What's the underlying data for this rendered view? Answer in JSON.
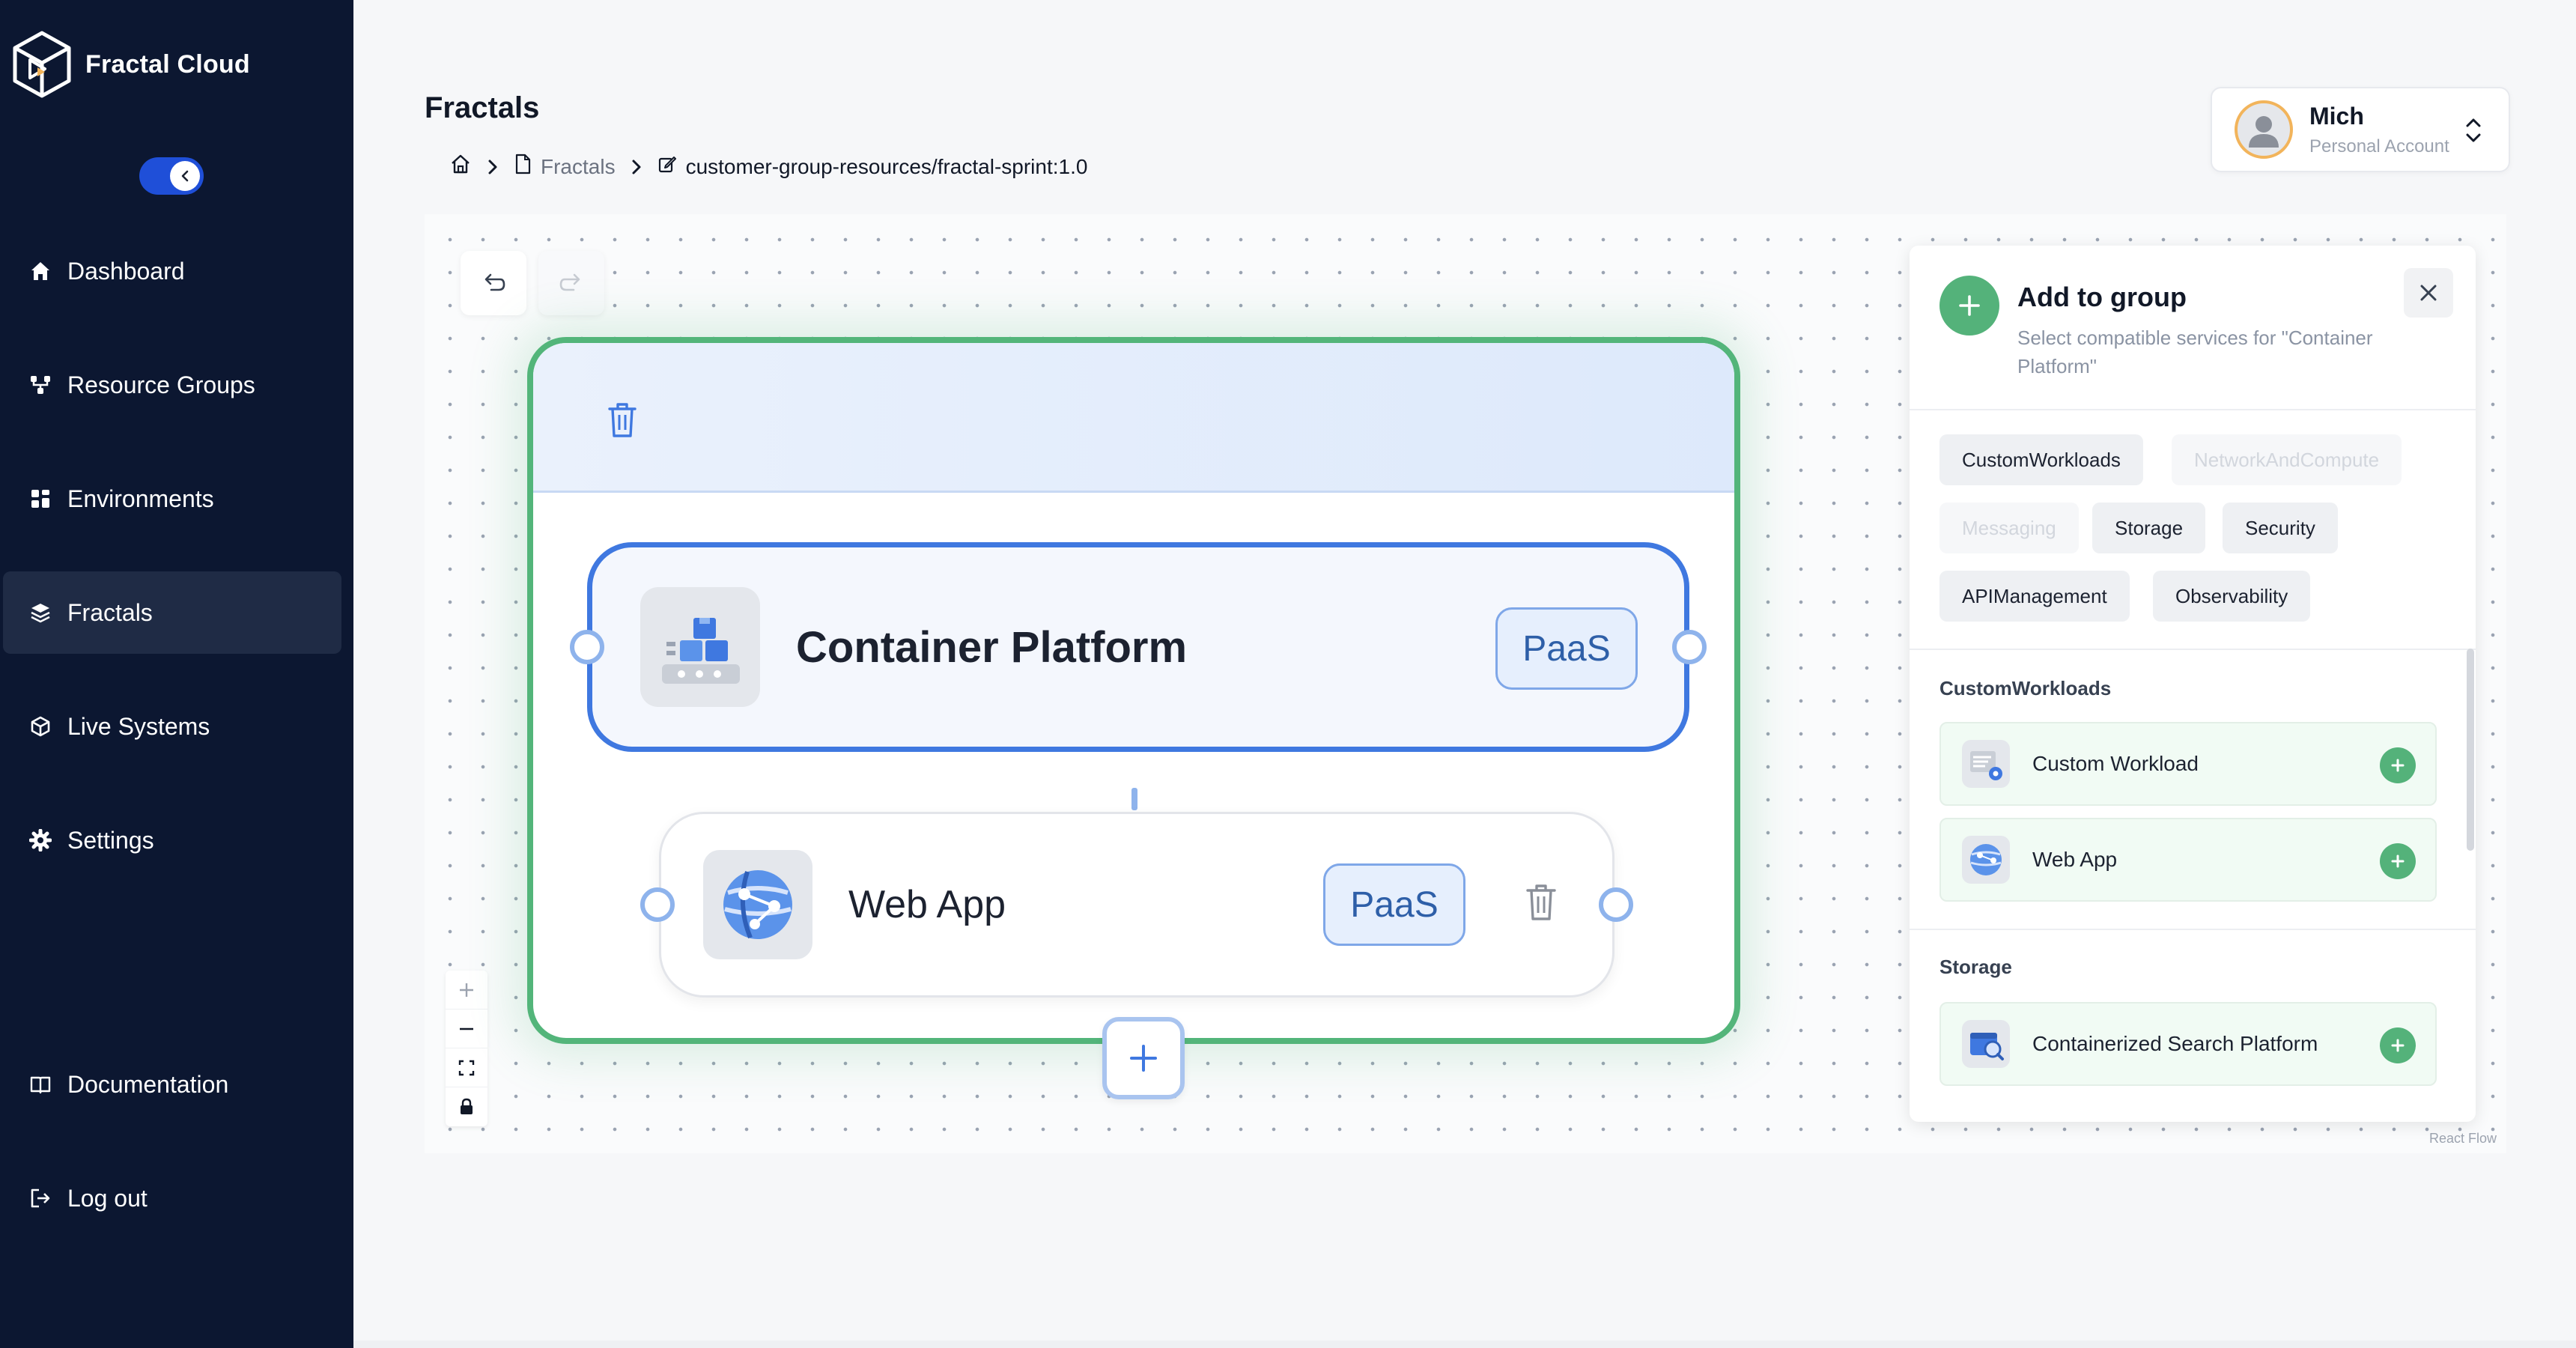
{
  "app": {
    "name": "Fractal Cloud"
  },
  "sidebar": {
    "items": [
      {
        "label": "Dashboard",
        "icon": "home-icon"
      },
      {
        "label": "Resource Groups",
        "icon": "hierarchy-icon"
      },
      {
        "label": "Environments",
        "icon": "grid-icon"
      },
      {
        "label": "Fractals",
        "icon": "layers-icon",
        "active": true
      },
      {
        "label": "Live Systems",
        "icon": "cube-icon"
      },
      {
        "label": "Settings",
        "icon": "gear-icon"
      }
    ],
    "footer": [
      {
        "label": "Documentation",
        "icon": "book-icon"
      },
      {
        "label": "Log out",
        "icon": "logout-icon"
      }
    ]
  },
  "header": {
    "title": "Fractals",
    "breadcrumb": {
      "link": "Fractals",
      "current": "customer-group-resources/fractal-sprint:1.0"
    }
  },
  "account": {
    "name": "Mich",
    "type": "Personal Account"
  },
  "canvas": {
    "group_node": {
      "container_platform": {
        "title": "Container Platform",
        "badge": "PaaS"
      },
      "web_app": {
        "title": "Web App",
        "badge": "PaaS"
      }
    },
    "attribution": "React Flow"
  },
  "panel": {
    "title": "Add to group",
    "subtitle": "Select compatible services for \"Container Platform\"",
    "chips": [
      {
        "label": "CustomWorkloads",
        "enabled": true
      },
      {
        "label": "NetworkAndCompute",
        "enabled": false
      },
      {
        "label": "Messaging",
        "enabled": false
      },
      {
        "label": "Storage",
        "enabled": true
      },
      {
        "label": "Security",
        "enabled": true
      },
      {
        "label": "APIManagement",
        "enabled": true
      },
      {
        "label": "Observability",
        "enabled": true
      }
    ],
    "sections": [
      {
        "label": "CustomWorkloads",
        "services": [
          "Custom Workload",
          "Web App"
        ]
      },
      {
        "label": "Storage",
        "services": [
          "Containerized Search Platform"
        ]
      }
    ]
  },
  "colors": {
    "sidebar_bg": "#0c1731",
    "accent_green": "#54b27a",
    "accent_blue": "#3f78e0",
    "toggle_blue": "#1f4fd8"
  }
}
